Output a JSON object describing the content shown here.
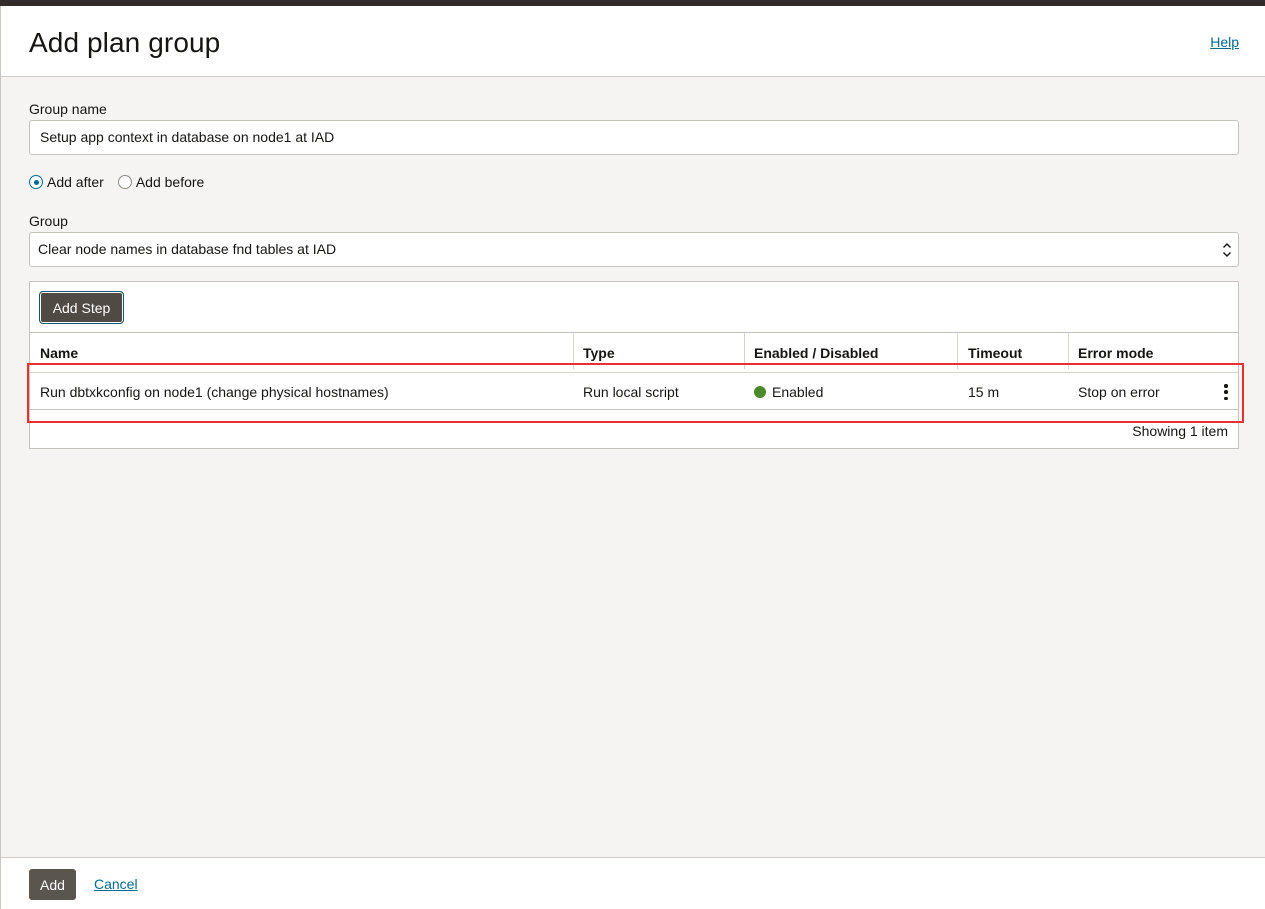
{
  "header": {
    "title": "Add plan group",
    "help_label": "Help"
  },
  "form": {
    "group_name_label": "Group name",
    "group_name_value": "Setup app context in database on node1 at IAD",
    "position_options": [
      {
        "label": "Add after",
        "checked": true
      },
      {
        "label": "Add before",
        "checked": false
      }
    ],
    "group_label": "Group",
    "group_selected": "Clear node names in database fnd tables at IAD"
  },
  "steps": {
    "add_step_label": "Add Step",
    "columns": [
      "Name",
      "Type",
      "Enabled / Disabled",
      "Timeout",
      "Error mode"
    ],
    "rows": [
      {
        "name": "Run dbtxkconfig on node1 (change physical hostnames)",
        "type": "Run local script",
        "status": "Enabled",
        "status_color": "#4a8a2a",
        "timeout": "15 m",
        "error_mode": "Stop on error",
        "actions_icon": "kebab-menu-icon"
      }
    ],
    "footer": "Showing 1 item"
  },
  "actions": {
    "add_label": "Add",
    "cancel_label": "Cancel"
  },
  "colors": {
    "accent": "#006b8f",
    "highlight": "#e8312f",
    "primary_button": "#504a45"
  }
}
